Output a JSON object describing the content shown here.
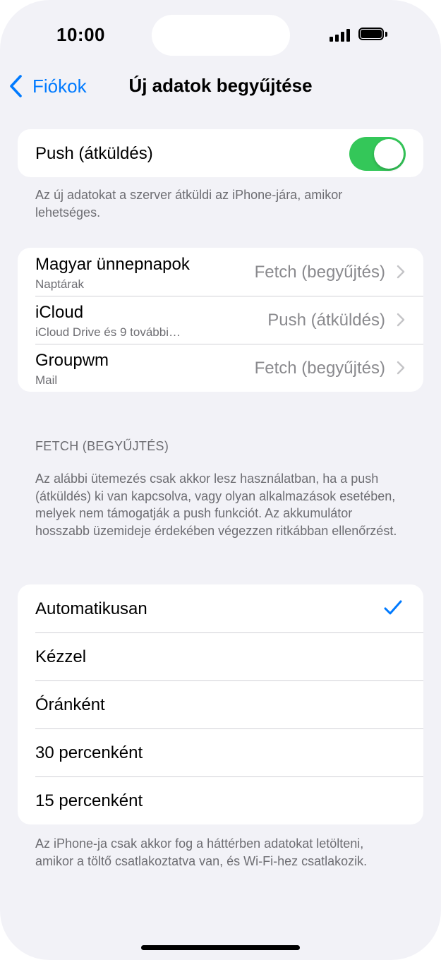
{
  "status_bar": {
    "time": "10:00"
  },
  "nav": {
    "back_label": "Fiókok",
    "title": "Új adatok begyűjtése"
  },
  "push": {
    "label": "Push (átküldés)",
    "enabled": true,
    "footnote": "Az új adatokat a szerver átküldi az iPhone-jára, amikor lehetséges."
  },
  "accounts": [
    {
      "title": "Magyar ünnepnapok",
      "subtitle": "Naptárak",
      "value": "Fetch (begyűjtés)"
    },
    {
      "title": "iCloud",
      "subtitle": "iCloud Drive és 9 további…",
      "value": "Push (átküldés)"
    },
    {
      "title": "Groupwm",
      "subtitle": "Mail",
      "value": "Fetch (begyűjtés)"
    }
  ],
  "fetch": {
    "header": "FETCH (BEGYŰJTÉS)",
    "description": "Az alábbi ütemezés csak akkor lesz használatban, ha a push (átküldés) ki van kapcsolva, vagy olyan alkalmazások esetében, melyek nem támogatják a push funkciót. Az akkumulátor hosszabb üzemideje érdekében végezzen ritkábban ellenőrzést.",
    "options": [
      "Automatikusan",
      "Kézzel",
      "Óránként",
      "30 percenként",
      "15 percenként"
    ],
    "selected": "Automatikusan",
    "footnote": "Az iPhone-ja csak akkor fog a háttérben adatokat letölteni, amikor a töltő csatlakoztatva van, és Wi-Fi-hez csatlakozik."
  },
  "colors": {
    "accent": "#007aff",
    "toggle_on": "#34c759",
    "background": "#f2f2f7"
  }
}
